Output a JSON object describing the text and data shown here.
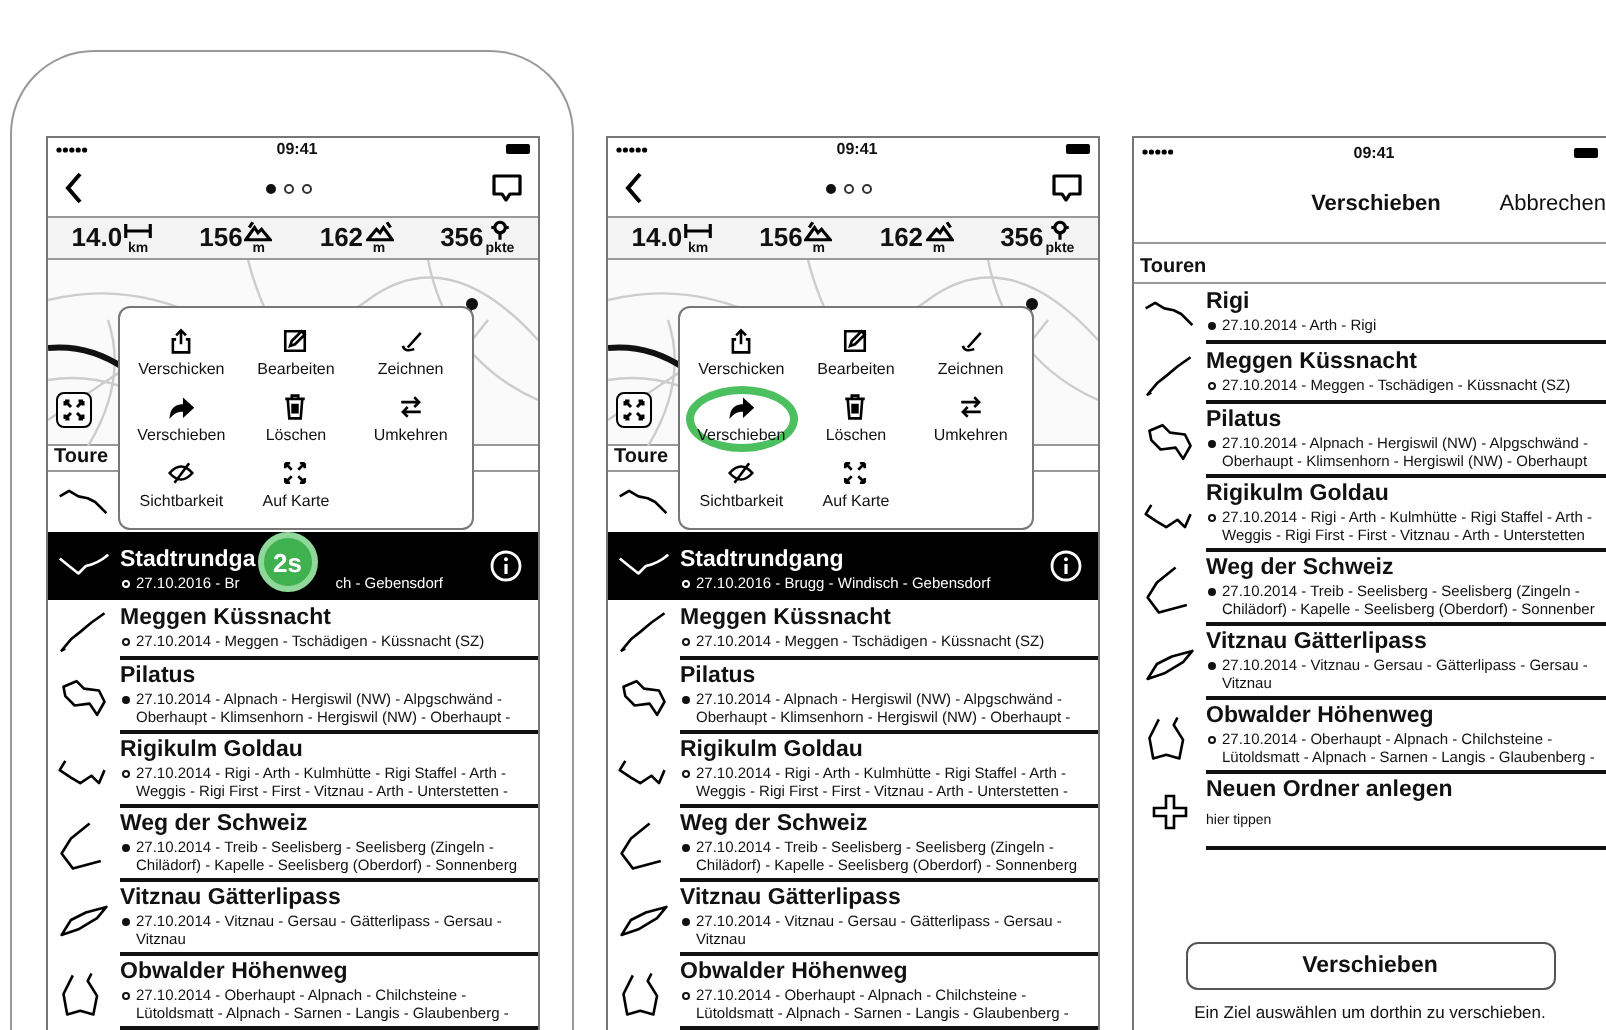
{
  "screens": [
    {
      "kind": "detail",
      "device_frame": true,
      "status_time": "09:41",
      "page_dots": [
        {
          "selected": true
        },
        {
          "selected": false
        },
        {
          "selected": false
        }
      ],
      "stats": [
        {
          "kind": "distance",
          "value": "14.0",
          "unit": "km"
        },
        {
          "kind": "ascent",
          "value": "156",
          "unit": "m"
        },
        {
          "kind": "descent",
          "value": "162",
          "unit": "m"
        },
        {
          "kind": "points",
          "value": "356",
          "unit": "pkte"
        }
      ],
      "menu": {
        "items": [
          {
            "kind": "share",
            "label": "Verschicken",
            "pressed": false
          },
          {
            "kind": "edit",
            "label": "Bearbeiten",
            "pressed": false
          },
          {
            "kind": "draw",
            "label": "Zeichnen",
            "pressed": false
          },
          {
            "kind": "move",
            "label": "Verschieben",
            "pressed": false
          },
          {
            "kind": "delete",
            "label": "Löschen",
            "pressed": false
          },
          {
            "kind": "reverse",
            "label": "Umkehren",
            "pressed": false
          },
          {
            "kind": "hide",
            "label": "Sichtbarkeit",
            "pressed": false
          },
          {
            "kind": "fit",
            "label": "Auf Karte",
            "pressed": false
          }
        ]
      },
      "tours_header": "Toure",
      "tours": [
        {
          "kind": "tour",
          "selected": false
        },
        {
          "kind": "tour",
          "selected": true,
          "filled": false,
          "name": "Stadtrundga",
          "meta": "27.10.2016 - Br",
          "badge": "2s",
          "meta_after": "ch - Gebensdorf"
        },
        {
          "kind": "tour",
          "selected": false,
          "filled": false,
          "name": "Meggen Küssnacht",
          "meta": "27.10.2014 - Meggen - Tschädigen - Küssnacht (SZ)"
        },
        {
          "kind": "tour",
          "selected": false,
          "filled": true,
          "name": "Pilatus",
          "meta": "27.10.2014 - Alpnach - Hergiswil (NW) - Alpgschwänd - Oberhaupt - Klimsenhorn - Hergiswil (NW) - Oberhaupt -"
        },
        {
          "kind": "tour",
          "selected": false,
          "filled": false,
          "name": "Rigikulm Goldau",
          "meta": "27.10.2014 - Rigi - Arth - Kulmhütte - Rigi Staffel - Arth - Weggis - Rigi First - First - Vitznau - Arth - Unterstetten -"
        },
        {
          "kind": "tour",
          "selected": false,
          "filled": true,
          "name": "Weg der Schweiz",
          "meta": "27.10.2014 - Treib - Seelisberg - Seelisberg (Zingeln - Chilädorf) - Kapelle - Seelisberg (Oberdorf) - Sonnenberg"
        },
        {
          "kind": "tour",
          "selected": false,
          "filled": true,
          "name": "Vitznau Gätterlipass",
          "meta": "27.10.2014 - Vitznau - Gersau - Gätterlipass - Gersau - Vitznau"
        },
        {
          "kind": "tour",
          "selected": false,
          "filled": false,
          "name": "Obwalder Höhenweg",
          "meta": "27.10.2014 - Oberhaupt - Alpnach - Chilchsteine - Lütoldsmatt - Alpnach - Sarnen - Langis - Glaubenberg -"
        }
      ]
    },
    {
      "kind": "detail",
      "device_frame": false,
      "status_time": "09:41",
      "page_dots": [
        {
          "selected": true
        },
        {
          "selected": false
        },
        {
          "selected": false
        }
      ],
      "stats": [
        {
          "kind": "distance",
          "value": "14.0",
          "unit": "km"
        },
        {
          "kind": "ascent",
          "value": "156",
          "unit": "m"
        },
        {
          "kind": "descent",
          "value": "162",
          "unit": "m"
        },
        {
          "kind": "points",
          "value": "356",
          "unit": "pkte"
        }
      ],
      "menu": {
        "items": [
          {
            "kind": "share",
            "label": "Verschicken",
            "pressed": false
          },
          {
            "kind": "edit",
            "label": "Bearbeiten",
            "pressed": false
          },
          {
            "kind": "draw",
            "label": "Zeichnen",
            "pressed": false
          },
          {
            "kind": "move",
            "label": "Verschieben",
            "pressed": true
          },
          {
            "kind": "delete",
            "label": "Löschen",
            "pressed": false
          },
          {
            "kind": "reverse",
            "label": "Umkehren",
            "pressed": false
          },
          {
            "kind": "hide",
            "label": "Sichtbarkeit",
            "pressed": false
          },
          {
            "kind": "fit",
            "label": "Auf Karte",
            "pressed": false
          }
        ]
      },
      "tours_header": "Toure",
      "tours": [
        {
          "kind": "tour",
          "selected": false
        },
        {
          "kind": "tour",
          "selected": true,
          "filled": false,
          "name": "Stadtrundgang",
          "meta": "27.10.2016 - Brugg - Windisch - Gebensdorf"
        },
        {
          "kind": "tour",
          "selected": false,
          "filled": false,
          "name": "Meggen Küssnacht",
          "meta": "27.10.2014 - Meggen - Tschädigen - Küssnacht (SZ)"
        },
        {
          "kind": "tour",
          "selected": false,
          "filled": true,
          "name": "Pilatus",
          "meta": "27.10.2014 - Alpnach - Hergiswil (NW) - Alpgschwänd - Oberhaupt - Klimsenhorn - Hergiswil (NW) - Oberhaupt -"
        },
        {
          "kind": "tour",
          "selected": false,
          "filled": false,
          "name": "Rigikulm Goldau",
          "meta": "27.10.2014 - Rigi - Arth - Kulmhütte - Rigi Staffel - Arth - Weggis - Rigi First - First - Vitznau - Arth - Unterstetten -"
        },
        {
          "kind": "tour",
          "selected": false,
          "filled": true,
          "name": "Weg der Schweiz",
          "meta": "27.10.2014 - Treib - Seelisberg - Seelisberg (Zingeln - Chilädorf) - Kapelle - Seelisberg (Oberdorf) - Sonnenberg"
        },
        {
          "kind": "tour",
          "selected": false,
          "filled": true,
          "name": "Vitznau Gätterlipass",
          "meta": "27.10.2014 - Vitznau - Gersau - Gätterlipass - Gersau - Vitznau"
        },
        {
          "kind": "tour",
          "selected": false,
          "filled": false,
          "name": "Obwalder Höhenweg",
          "meta": "27.10.2014 - Oberhaupt - Alpnach - Chilchsteine - Lütoldsmatt - Alpnach - Sarnen - Langis - Glaubenberg -"
        }
      ]
    },
    {
      "kind": "move",
      "device_frame": false,
      "status_time": "09:41",
      "title": "Verschieben",
      "cancel": "Abbrechen",
      "tours_header": "Touren",
      "tours": [
        {
          "kind": "tour",
          "selected": false,
          "filled": true,
          "name": "Rigi",
          "meta": "27.10.2014 - Arth - Rigi"
        },
        {
          "kind": "tour",
          "selected": false,
          "filled": false,
          "name": "Meggen Küssnacht",
          "meta": "27.10.2014 - Meggen - Tschädigen - Küssnacht (SZ)"
        },
        {
          "kind": "tour",
          "selected": false,
          "filled": true,
          "name": "Pilatus",
          "meta": "27.10.2014 - Alpnach - Hergiswil (NW) - Alpgschwänd - Oberhaupt - Klimsenhorn - Hergiswil (NW) - Oberhaupt"
        },
        {
          "kind": "tour",
          "selected": false,
          "filled": false,
          "name": "Rigikulm Goldau",
          "meta": "27.10.2014 - Rigi - Arth - Kulmhütte - Rigi Staffel - Arth - Weggis - Rigi First - First - Vitznau - Arth - Unterstetten"
        },
        {
          "kind": "tour",
          "selected": false,
          "filled": true,
          "name": "Weg der Schweiz",
          "meta": "27.10.2014 - Treib - Seelisberg - Seelisberg (Zingeln - Chilädorf) - Kapelle - Seelisberg (Oberdorf) - Sonnenber"
        },
        {
          "kind": "tour",
          "selected": false,
          "filled": true,
          "name": "Vitznau Gätterlipass",
          "meta": "27.10.2014 - Vitznau - Gersau - Gätterlipass - Gersau - Vitznau"
        },
        {
          "kind": "tour",
          "selected": false,
          "filled": false,
          "name": "Obwalder Höhenweg",
          "meta": "27.10.2014 - Oberhaupt - Alpnach - Chilchsteine - Lütoldsmatt - Alpnach - Sarnen - Langis - Glaubenberg -"
        },
        {
          "kind": "new_folder",
          "selected": false,
          "name": "Neuen Ordner anlegen",
          "meta": "hier tippen"
        }
      ],
      "move_button": "Verschieben",
      "hint": "Ein Ziel auswählen um dorthin zu verschieben."
    }
  ]
}
